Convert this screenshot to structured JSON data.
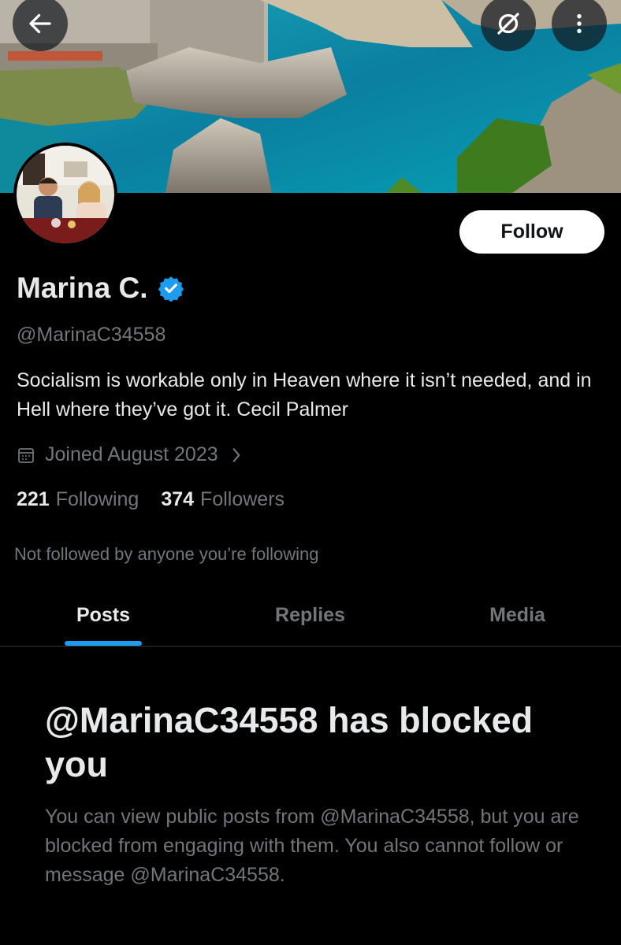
{
  "header": {
    "back_icon": "arrow-left-icon",
    "grok_icon": "grok-icon",
    "more_icon": "more-vertical-icon"
  },
  "profile": {
    "name": "Marina C.",
    "verified": true,
    "handle": "@MarinaC34558",
    "bio": "Socialism is workable only in Heaven where it isn’t needed, and in Hell where they’ve got it. Cecil Palmer",
    "joined": "Joined August 2023",
    "following_count": "221",
    "following_label": "Following",
    "followers_count": "374",
    "followers_label": "Followers",
    "not_followed_text": "Not followed by anyone you’re following"
  },
  "actions": {
    "follow_label": "Follow"
  },
  "tabs": [
    {
      "label": "Posts",
      "active": true
    },
    {
      "label": "Replies",
      "active": false
    },
    {
      "label": "Media",
      "active": false
    }
  ],
  "blocked": {
    "title": "@MarinaC34558 has blocked you",
    "message": "You can view public posts from @MarinaC34558, but you are blocked from engaging with them. You also cannot follow or message @MarinaC34558."
  },
  "colors": {
    "accent": "#1d9bf0",
    "background": "#000000",
    "secondary_text": "#71767b"
  }
}
